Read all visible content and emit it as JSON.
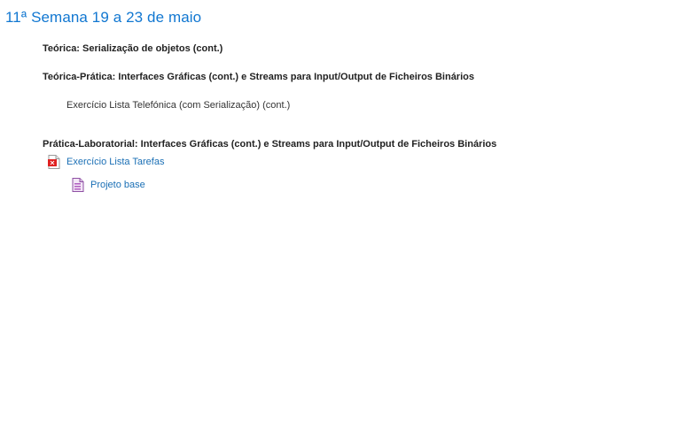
{
  "section": {
    "title": "11ª Semana 19 a 23 de maio"
  },
  "content": {
    "teorica": "Teórica: Serialização de objetos (cont.)",
    "teorico_pratica": "Teórica-Prática: Interfaces Gráficas (cont.) e Streams para Input/Output de Ficheiros Binários",
    "exercicio": "Exercício Lista Telefónica (com Serialização) (cont.)",
    "pratica_laboratorial": "Prática-Laboratorial: Interfaces Gráficas (cont.) e Streams para Input/Output de Ficheiros Binários"
  },
  "activities": [
    {
      "label": "Exercício Lista Tarefas",
      "icon": "pdf-icon",
      "icon_color": "#e02020"
    },
    {
      "label": "Projeto base",
      "icon": "archive-icon",
      "icon_color": "#b05cc0"
    }
  ],
  "colors": {
    "title": "#1177d1",
    "link": "#1a6fb5",
    "heading": "#222222"
  }
}
